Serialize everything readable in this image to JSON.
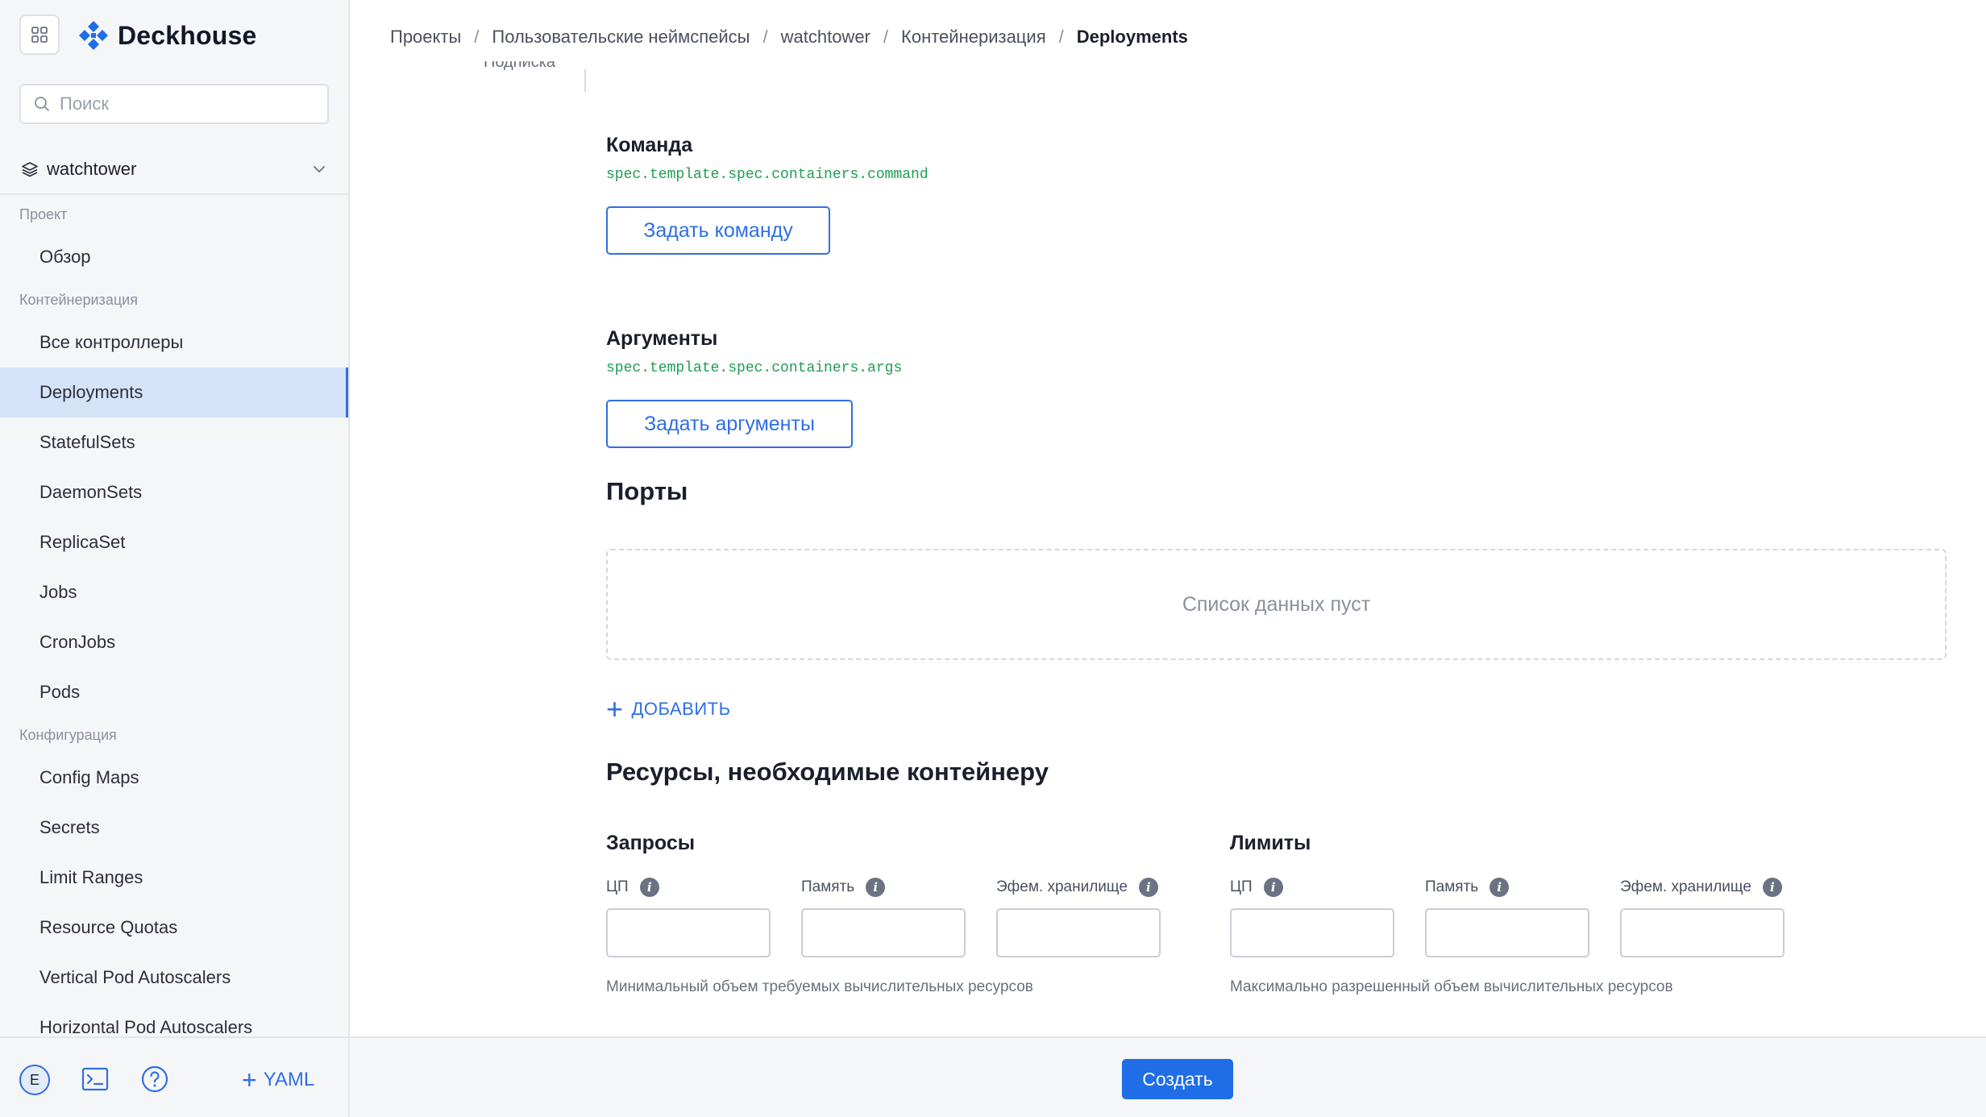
{
  "app": {
    "name": "Deckhouse"
  },
  "search": {
    "placeholder": "Поиск"
  },
  "namespace": {
    "selected": "watchtower"
  },
  "sidebar": {
    "sections": [
      {
        "title": "Проект",
        "items": [
          "Обзор"
        ]
      },
      {
        "title": "Контейнеризация",
        "items": [
          "Все контроллеры",
          "Deployments",
          "StatefulSets",
          "DaemonSets",
          "ReplicaSet",
          "Jobs",
          "CronJobs",
          "Pods"
        ]
      },
      {
        "title": "Конфигурация",
        "items": [
          "Config Maps",
          "Secrets",
          "Limit Ranges",
          "Resource Quotas",
          "Vertical Pod Autoscalers",
          "Horizontal Pod Autoscalers"
        ]
      }
    ],
    "active_item": "Deployments",
    "footer": {
      "avatar_initial": "E",
      "yaml_label": "YAML"
    }
  },
  "breadcrumb": [
    "Проекты",
    "Пользовательские неймспейсы",
    "watchtower",
    "Контейнеризация",
    "Deployments"
  ],
  "form": {
    "cut_label": "Подписка",
    "command": {
      "title": "Команда",
      "path": "spec.template.spec.containers.command",
      "button": "Задать команду"
    },
    "args": {
      "title": "Аргументы",
      "path": "spec.template.spec.containers.args",
      "button": "Задать аргументы"
    },
    "ports": {
      "title": "Порты",
      "empty": "Список данных пуст",
      "add": "ДОБАВИТЬ"
    },
    "resources": {
      "title": "Ресурсы, необходимые контейнеру",
      "requests": {
        "title": "Запросы",
        "labels": [
          "ЦП",
          "Память",
          "Эфем. хранилище"
        ],
        "hint": "Минимальный объем требуемых вычислительных ресурсов"
      },
      "limits": {
        "title": "Лимиты",
        "labels": [
          "ЦП",
          "Память",
          "Эфем. хранилище"
        ],
        "hint": "Максимально разрешенный объем вычислительных ресурсов"
      }
    }
  },
  "actions": {
    "create": "Создать"
  },
  "colors": {
    "accent": "#2f6fe4",
    "active_bg": "#d5e3f8",
    "path_green": "#1f9d55"
  },
  "icons": [
    "apps-grid-icon",
    "deckhouse-logo-icon",
    "search-icon",
    "layers-icon",
    "chevron-down-icon",
    "terminal-icon",
    "help-icon",
    "plus-icon",
    "info-icon"
  ]
}
